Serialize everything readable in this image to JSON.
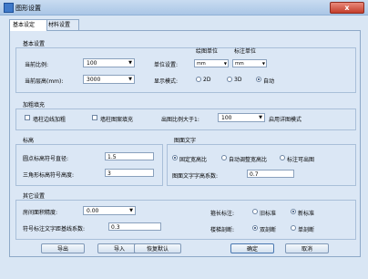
{
  "window": {
    "title": "图形设置",
    "close_label": "x"
  },
  "tabs": [
    "基本设定",
    "材料设置"
  ],
  "basic": {
    "title": "基本设置",
    "scale_label": "当前比例:",
    "scale_value": "100",
    "height_label": "当前层高(mm):",
    "height_value": "3000",
    "unit_label": "单位设置:",
    "unit_header_draw": "绘图单位",
    "unit_header_annot": "标注单位",
    "unit_draw_value": "mm",
    "unit_annot_value": "mm",
    "display_label": "显示模式:",
    "display_options": [
      "2D",
      "3D",
      "自动"
    ],
    "display_selected": "自动"
  },
  "fill": {
    "title": "加粗填充",
    "edge_label": "墙柱边线加粗",
    "pattern_label": "墙柱图案填充",
    "scale_over_label": "出图比例大于1:",
    "scale_over_value": "100",
    "detail_label": "启用详图模式"
  },
  "elevation": {
    "title": "标高",
    "circle_label": "圆点标高符号直径:",
    "circle_value": "1.5",
    "triangle_label": "三角形标高符号高度:",
    "triangle_value": "3"
  },
  "text": {
    "title": "图面文字",
    "options": [
      "固定宽高比",
      "自动调整宽高比",
      "标注可出图"
    ],
    "selected": "固定宽高比",
    "ratio_label": "图面文字字高系数:",
    "ratio_value": "0.7"
  },
  "other": {
    "title": "其它设置",
    "area_label": "房间面积精度:",
    "area_value": "0.00",
    "offset_label": "符号标注文字距基线系数:",
    "offset_value": "0.3",
    "dim_label": "箍长标注:",
    "dim_options": [
      "旧标准",
      "新标准"
    ],
    "dim_selected": "新标准",
    "break_label": "楼梯剖断:",
    "break_options": [
      "双剖断",
      "单剖断"
    ],
    "break_selected": "双剖断"
  },
  "buttons": {
    "export": "导出",
    "import": "导入",
    "restore": "恢复默认",
    "ok": "确定",
    "cancel": "取消"
  }
}
